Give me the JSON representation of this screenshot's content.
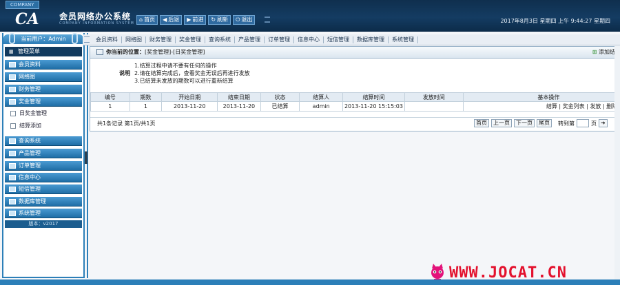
{
  "header": {
    "badge": "COMPANY",
    "logo_text": "CA",
    "title": "会员网络办公系统",
    "subtitle": "COMPANY INFORMATION SYSTEM",
    "nav": [
      {
        "label": "首页",
        "icon": "home-icon"
      },
      {
        "label": "后退",
        "icon": "back-icon"
      },
      {
        "label": "前进",
        "icon": "forward-icon"
      },
      {
        "label": "刷新",
        "icon": "refresh-icon"
      },
      {
        "label": "退出",
        "icon": "power-icon"
      }
    ],
    "datetime": "2017年8月3日 星期四 上午 9:44:27 星期四"
  },
  "sidebar": {
    "user": "当前用户：Admin",
    "menu_title": "管理菜单",
    "items": [
      {
        "label": "会员资料"
      },
      {
        "label": "网络图"
      },
      {
        "label": "财务管理"
      },
      {
        "label": "奖金管理"
      },
      {
        "label": "查询系统"
      },
      {
        "label": "产品管理"
      },
      {
        "label": "订单管理"
      },
      {
        "label": "信息中心"
      },
      {
        "label": "短信管理"
      },
      {
        "label": "数据库管理"
      },
      {
        "label": "系统管理"
      }
    ],
    "subitems": [
      {
        "label": "日奖金管理"
      },
      {
        "label": "结算添加"
      }
    ],
    "version": "版本：v2017"
  },
  "tabs": [
    "会员资料",
    "网络图",
    "财务管理",
    "奖金管理",
    "查询系统",
    "产品管理",
    "订单管理",
    "信息中心",
    "短信管理",
    "数据库管理",
    "系统管理"
  ],
  "main": {
    "location_label": "你当前的位置：",
    "location_path": "[奖金管理]-[日奖金管理]",
    "right_action": "添加结算",
    "notes_label": "说明",
    "notes": [
      "1.结算过程中请不要有任何的操作",
      "2.请在结算完成后，查看奖金无误后再进行发放",
      "3.已结算未发放的期数可以进行重新结算"
    ],
    "table": {
      "headers": [
        "编号",
        "期数",
        "开始日期",
        "结束日期",
        "状态",
        "结算人",
        "结算时间",
        "发放时间",
        "基本操作"
      ],
      "rows": [
        [
          "1",
          "1",
          "2013-11-20",
          "2013-11-20",
          "已结算",
          "admin",
          "2013-11-20 15:15:03",
          "",
          "结算 | 奖金列表 | 发放 | 删除 | 不显"
        ]
      ]
    },
    "pager": {
      "info": "共1条记录  第1页/共1页",
      "first": "首页",
      "prev": "上一页",
      "next": "下一页",
      "last": "尾页",
      "goto_label": "转到第",
      "page_unit": "页"
    }
  },
  "watermark": "WWW.JOCAT.CN",
  "colors": {
    "header_bg": "#143c62",
    "menu_blue": "#2d7bb5",
    "watermark": "#e3122e"
  }
}
